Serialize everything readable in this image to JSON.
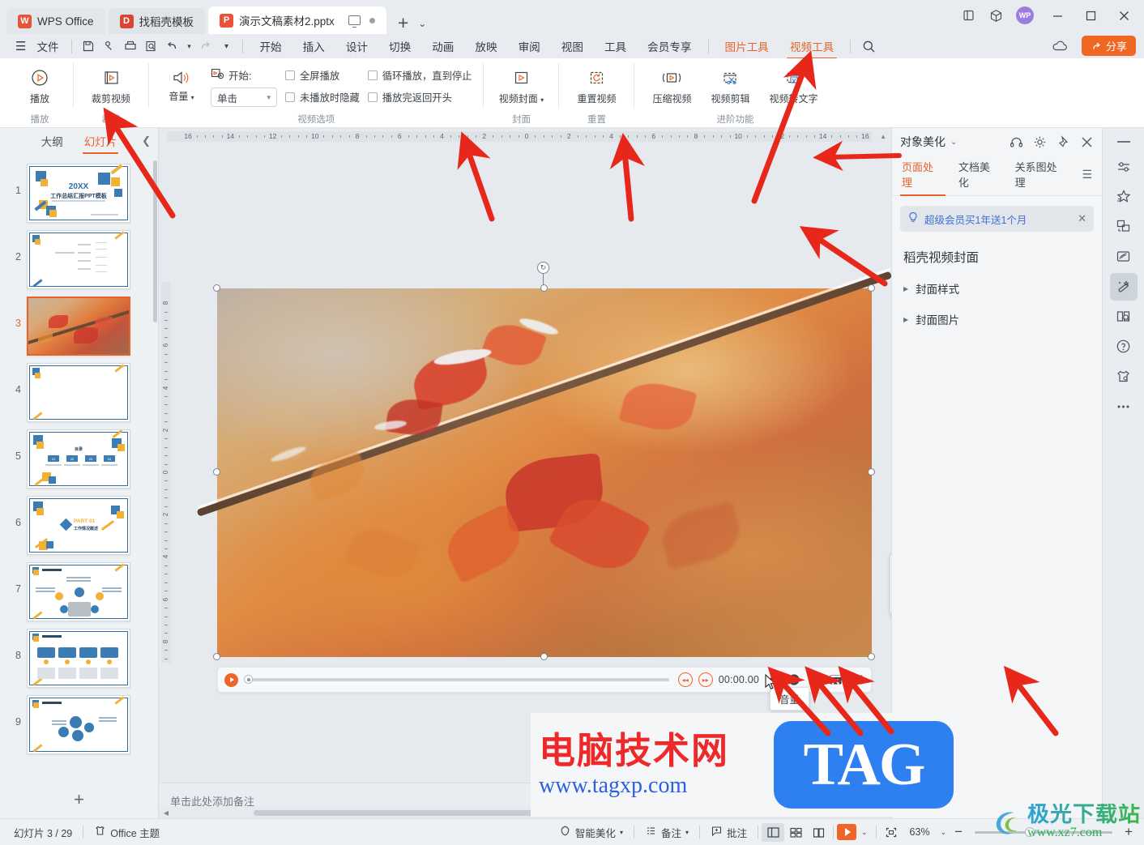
{
  "titlebar": {
    "tabs": [
      {
        "label": "WPS Office",
        "icon": "wps-logo-icon"
      },
      {
        "label": "找稻壳模板",
        "icon": "docer-icon"
      },
      {
        "label": "演示文稿素材2.pptx",
        "icon": "pptx-file-icon"
      }
    ],
    "new_tab": "+",
    "tab_dropdown": "⌄",
    "right_icons": [
      "dual-screen-icon",
      "cube-icon"
    ],
    "avatar": "WP",
    "window_buttons": [
      "minimize",
      "maximize",
      "close"
    ]
  },
  "menubar": {
    "file_label": "文件",
    "quick_icons": [
      "save-icon",
      "print-preview-icon",
      "print-icon",
      "find-icon",
      "undo-icon",
      "undo-dropdown-icon",
      "redo-icon",
      "more-dropdown-icon"
    ],
    "tabs": [
      "开始",
      "插入",
      "设计",
      "切换",
      "动画",
      "放映",
      "审阅",
      "视图",
      "工具",
      "会员专享"
    ],
    "context_tabs": [
      {
        "label": "图片工具",
        "active": false
      },
      {
        "label": "视频工具",
        "active": true
      }
    ],
    "search_icon": "search-icon",
    "cloud_icon": "cloud-icon",
    "share_label": "分享",
    "share_color": "#f06724"
  },
  "ribbon": {
    "groups": [
      {
        "name": "播放",
        "label": "播放",
        "buttons": [
          {
            "label": "播放",
            "icon": "play-circle-icon"
          }
        ]
      },
      {
        "name": "裁剪",
        "label": "裁剪",
        "buttons": [
          {
            "label": "裁剪视频",
            "icon": "trim-video-icon"
          }
        ]
      },
      {
        "name": "视频选项",
        "label": "视频选项",
        "volume_label": "音量",
        "volume_icon": "speaker-icon",
        "start_label": "开始:",
        "start_icon": "start-clock-icon",
        "start_value": "单击",
        "checkboxes": [
          {
            "label": "全屏播放",
            "checked": false
          },
          {
            "label": "循环播放，直到停止",
            "checked": false
          },
          {
            "label": "未播放时隐藏",
            "checked": false
          },
          {
            "label": "播放完返回开头",
            "checked": false
          }
        ]
      },
      {
        "name": "封面",
        "label": "封面",
        "buttons": [
          {
            "label": "视频封面",
            "icon": "video-poster-icon",
            "has_caret": true
          }
        ]
      },
      {
        "name": "重置",
        "label": "重置",
        "buttons": [
          {
            "label": "重置视频",
            "icon": "reset-video-icon"
          }
        ]
      },
      {
        "name": "进阶功能",
        "label": "进阶功能",
        "buttons": [
          {
            "label": "压缩视频",
            "icon": "compress-video-icon"
          },
          {
            "label": "视频剪辑",
            "icon": "video-edit-icon"
          },
          {
            "label": "视频转文字",
            "icon": "video-to-text-icon"
          }
        ]
      }
    ]
  },
  "slide_pane": {
    "tabs": [
      {
        "label": "大纲",
        "active": false
      },
      {
        "label": "幻灯片",
        "active": true
      }
    ],
    "collapse_icon": "chevron-left-icon",
    "add_slide": "+",
    "slides": [
      {
        "number": "1",
        "type": "title",
        "title_top": "20XX",
        "title_main": "工作总结汇报PPT模板"
      },
      {
        "number": "2",
        "type": "mindmap"
      },
      {
        "number": "3",
        "type": "video",
        "selected": true
      },
      {
        "number": "4",
        "type": "blank"
      },
      {
        "number": "5",
        "type": "toc",
        "heading": "目录",
        "items": [
          "01",
          "02",
          "03",
          "04"
        ]
      },
      {
        "number": "6",
        "type": "section",
        "part": "PART 01",
        "sub": "工作情况概述"
      },
      {
        "number": "7",
        "type": "diagram"
      },
      {
        "number": "8",
        "type": "cards"
      },
      {
        "number": "9",
        "type": "bubbles"
      }
    ]
  },
  "ruler": {
    "horizontal_ticks": [
      "16",
      "14",
      "12",
      "10",
      "8",
      "6",
      "4",
      "2",
      "0",
      "2",
      "4",
      "6",
      "8",
      "10",
      "12",
      "14",
      "16"
    ],
    "vertical_ticks": [
      "8",
      "6",
      "4",
      "2",
      "0",
      "2",
      "4",
      "6",
      "8"
    ]
  },
  "video_player": {
    "play_icon": "play-icon",
    "rewind_icon": "rewind-icon",
    "forward_icon": "forward-icon",
    "time": "00:00.00",
    "icons": [
      {
        "name": "volume-icon",
        "glyph": "speaker"
      },
      {
        "name": "info-icon",
        "glyph": "exclamation"
      },
      {
        "name": "poster-image-icon",
        "glyph": "image"
      },
      {
        "name": "video-clip-icon",
        "glyph": "scissors"
      },
      {
        "name": "video-to-text-icon",
        "glyph": "doc"
      }
    ],
    "tooltip": "音量"
  },
  "notes": {
    "placeholder": "单击此处添加备注"
  },
  "right_panel": {
    "title": "对象美化",
    "caret": "⌄",
    "header_icons": [
      "headphone-icon",
      "settings-gear-icon",
      "pin-icon",
      "close-icon"
    ],
    "tabs": [
      {
        "label": "页面处理",
        "active": true
      },
      {
        "label": "文档美化",
        "active": false
      },
      {
        "label": "关系图处理",
        "active": false
      }
    ],
    "menu_icon": "hamburger-icon",
    "promo": {
      "icon": "lightbulb-icon",
      "text": "超级会员买1年送1个月",
      "close": "✕",
      "color": "#3f6fd8"
    },
    "section_title": "稻壳视频封面",
    "rows": [
      {
        "label": "封面样式",
        "expanded": false
      },
      {
        "label": "封面图片",
        "expanded": false
      }
    ]
  },
  "rail": {
    "icons": [
      {
        "name": "collapse-dash-icon",
        "active": false
      },
      {
        "name": "sliders-icon",
        "active": false
      },
      {
        "name": "star-sparkle-icon",
        "active": false
      },
      {
        "name": "shapes-icon",
        "active": false
      },
      {
        "name": "feather-icon",
        "active": false
      },
      {
        "name": "magic-wand-icon",
        "active": true
      },
      {
        "name": "book-search-icon",
        "active": false
      },
      {
        "name": "help-circle-icon",
        "active": false
      },
      {
        "name": "tshirt-icon",
        "active": false
      },
      {
        "name": "more-dots-icon",
        "active": false
      }
    ]
  },
  "statusbar": {
    "slide_counter": "幻灯片 3 / 29",
    "theme_icon": "theme-icon",
    "theme_label": "Office 主题",
    "beautify_icon": "beautify-icon",
    "beautify_label": "智能美化",
    "notes_icon": "notes-icon",
    "notes_label": "备注",
    "comment_icon": "comment-icon",
    "comment_label": "批注",
    "views": [
      {
        "name": "normal-view-icon",
        "active": true
      },
      {
        "name": "slide-sorter-icon",
        "active": false
      },
      {
        "name": "reading-view-icon",
        "active": false
      }
    ],
    "play_button": "play-slideshow-icon",
    "play_caret": "⌄",
    "fit_icon": "fit-to-window-icon",
    "zoom_level": "63%",
    "zoom_caret": "⌄",
    "zoom_out": "−",
    "zoom_in": "+"
  },
  "watermarks": {
    "primary_cn": "电脑技术网",
    "primary_url": "www.tagxp.com",
    "primary_badge": "TAG",
    "secondary_cn": "极光下载站",
    "secondary_url": "www.xz7.com"
  },
  "annotations": {
    "arrow_count": 9,
    "arrow_color": "#e8271b"
  }
}
